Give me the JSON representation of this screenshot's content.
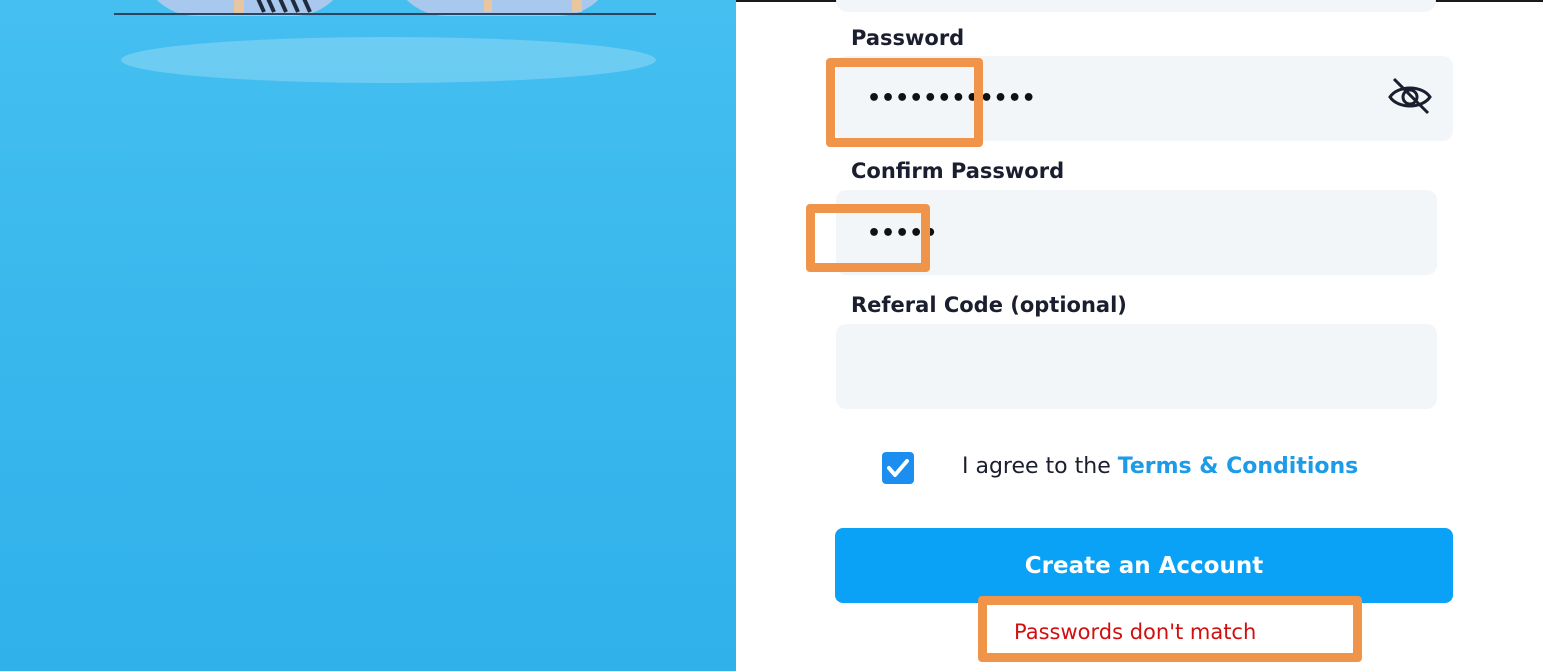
{
  "form": {
    "password": {
      "label": "Password",
      "value_masked": "••••••••••••",
      "toggle_icon": "eye-slash-icon"
    },
    "confirm_password": {
      "label": "Confirm Password",
      "value_masked": "•••••"
    },
    "referral": {
      "label": "Referal Code (optional)",
      "value": ""
    },
    "terms": {
      "checked": true,
      "prefix": "I agree to the ",
      "link_text": "Terms & Conditions"
    },
    "submit_label": "Create an Account",
    "error_message": "Passwords don't match"
  },
  "colors": {
    "left_panel": "#3bbaf0",
    "button": "#0aa2f6",
    "link": "#1b9be8",
    "error": "#d20f0f",
    "highlight": "#f0944a",
    "field_bg": "#f3f6f9"
  }
}
